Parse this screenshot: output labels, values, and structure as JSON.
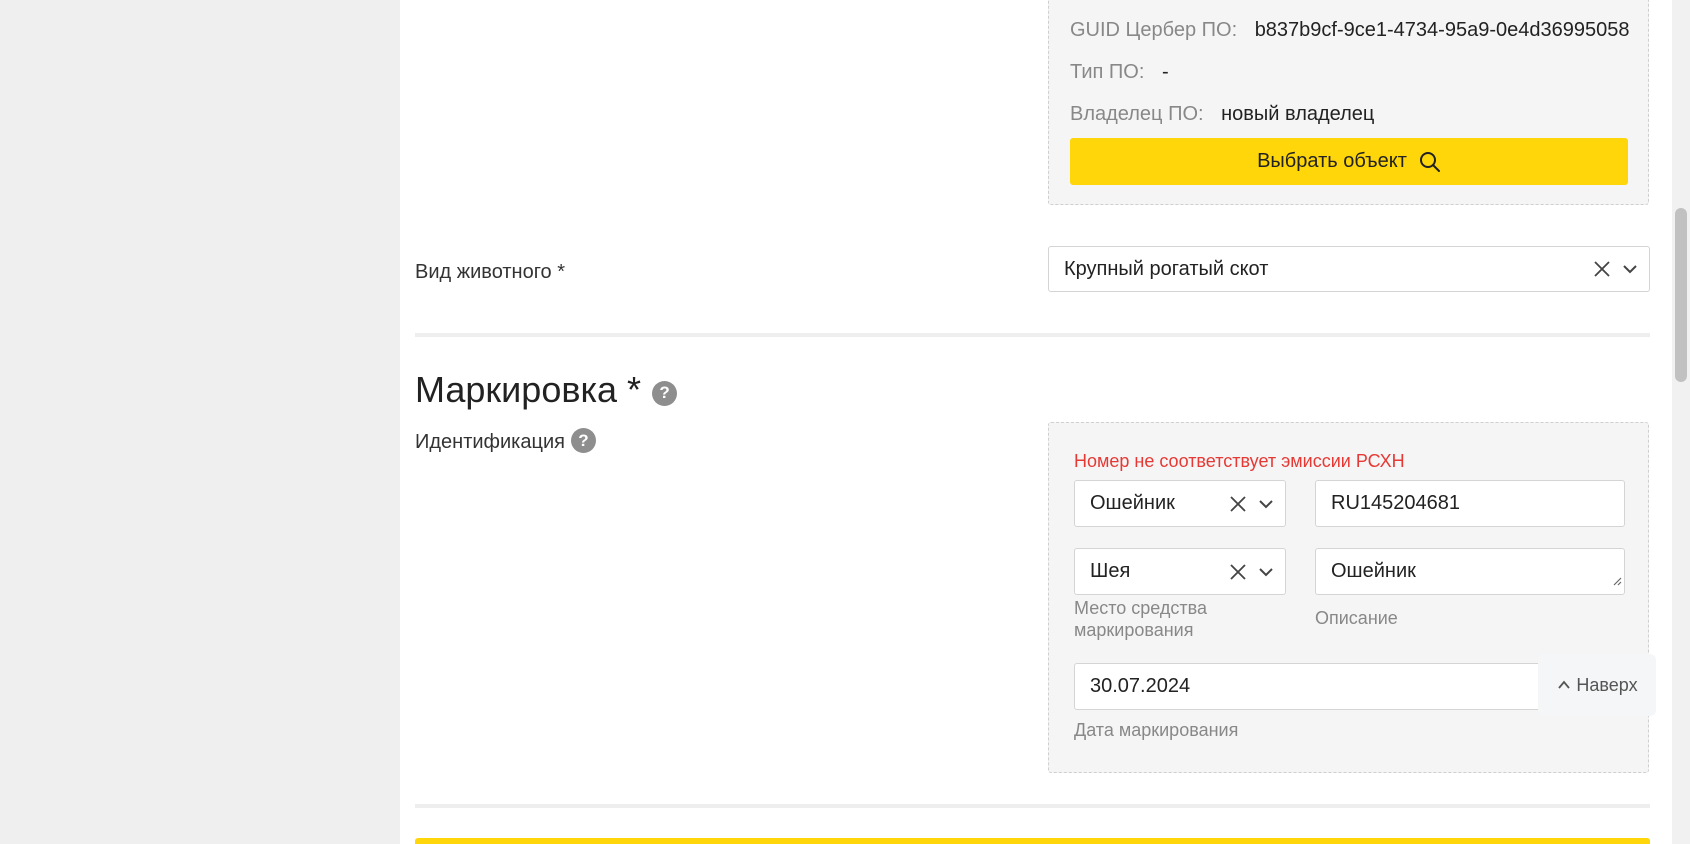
{
  "owner_card": {
    "guid_label": "GUID Цербер ПО:",
    "guid_value": "b837b9cf-9ce1-4734-95a9-0e4d36995058",
    "type_label": "Тип ПО:",
    "type_value": "-",
    "owner_label": "Владелец ПО:",
    "owner_value": "новый владелец",
    "select_button_label": "Выбрать объект"
  },
  "animal_type": {
    "label": "Вид животного *",
    "value": "Крупный рогатый скот"
  },
  "marking": {
    "title": "Маркировка *",
    "identification_label": "Идентификация",
    "error_text": "Номер не соответствует эмиссии РСХН",
    "means_value": "Ошейник",
    "number_value": "RU145204681",
    "place_value": "Шея",
    "place_label": "Место средства маркирования",
    "description_value": "Ошейник",
    "description_label": "Описание",
    "date_value": "30.07.2024",
    "date_label": "Дата маркирования"
  },
  "to_top": {
    "label": "Наверх"
  },
  "colors": {
    "accent_yellow": "#ffd60a",
    "error_red": "#e53935",
    "help_gray": "#8e8e8e"
  },
  "icons": [
    "search-icon",
    "clear-icon",
    "chevron-down-icon",
    "help-icon",
    "chevron-up-icon",
    "resize-handle-icon"
  ]
}
